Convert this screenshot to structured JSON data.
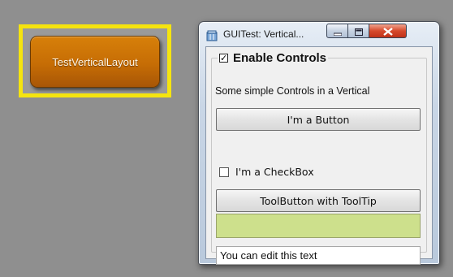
{
  "desktop": {
    "test_button_label": "TestVerticalLayout",
    "highlight_color": "#f5e40f"
  },
  "window": {
    "title": "GUITest: Vertical...",
    "icon": "app-window-icon",
    "controls": {
      "minimize_icon": "minimize-icon",
      "maximize_icon": "maximize-icon",
      "close_icon": "close-icon"
    }
  },
  "group": {
    "title": "Enable Controls",
    "checked": true,
    "description": "Some simple Controls in a Vertical",
    "button_label": "I'm a Button",
    "checkbox_label": "I'm a CheckBox",
    "checkbox_checked": false,
    "toolbutton_label": "ToolButton with ToolTip",
    "color_swatch": "#cde08c",
    "text_value": "You can edit this text"
  }
}
